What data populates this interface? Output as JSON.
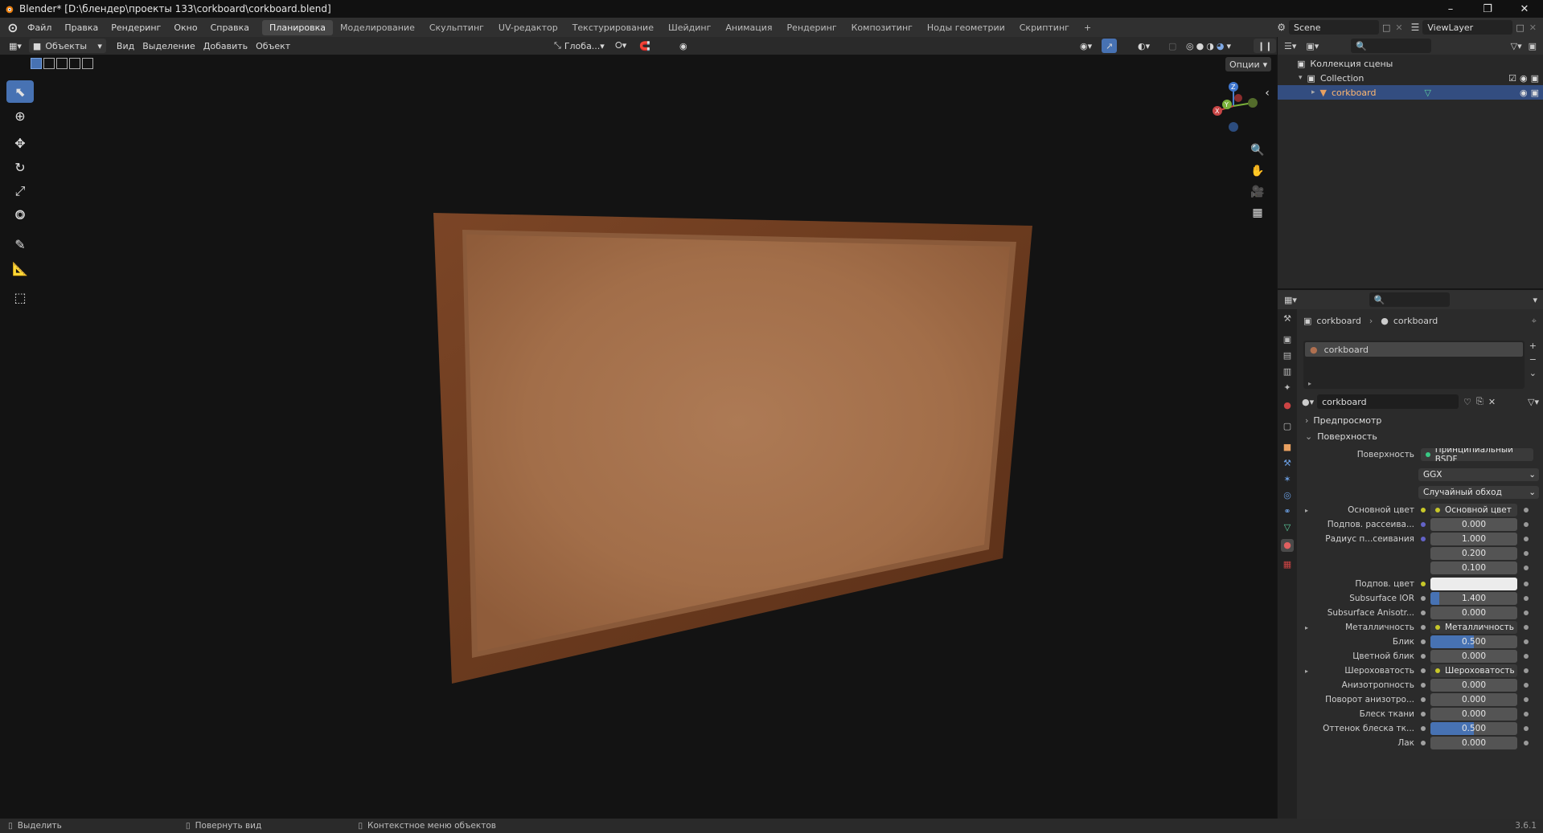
{
  "titlebar": {
    "title": "Blender* [D:\\блендер\\проекты 133\\corkboard\\corkboard.blend]",
    "minimize_icon": "minimize-icon",
    "maximize_icon": "maximize-icon",
    "close_icon": "close-icon"
  },
  "menu": {
    "file": "Файл",
    "edit": "Правка",
    "render": "Рендеринг",
    "window": "Окно",
    "help": "Справка"
  },
  "workspaces": [
    {
      "label": "Планировка",
      "active": true
    },
    {
      "label": "Моделирование"
    },
    {
      "label": "Скульптинг"
    },
    {
      "label": "UV-редактор"
    },
    {
      "label": "Текстурирование"
    },
    {
      "label": "Шейдинг"
    },
    {
      "label": "Анимация"
    },
    {
      "label": "Рендеринг"
    },
    {
      "label": "Композитинг"
    },
    {
      "label": "Ноды геометрии"
    },
    {
      "label": "Скриптинг"
    },
    {
      "label": "+"
    }
  ],
  "scene": {
    "label": "Scene",
    "viewlayer": "ViewLayer"
  },
  "viewport_header": {
    "mode": "Объекты",
    "view": "Вид",
    "select": "Выделение",
    "add": "Добавить",
    "object": "Объект",
    "transform_orientation": "Глоба...",
    "options": "Опции"
  },
  "outliner": {
    "scene_collection": "Коллекция сцены",
    "collection": "Collection",
    "object": "corkboard"
  },
  "properties": {
    "breadcrumb_object": "corkboard",
    "breadcrumb_material": "corkboard",
    "slot": "corkboard",
    "material_name": "corkboard",
    "panel_preview": "Предпросмотр",
    "panel_surface": "Поверхность",
    "surface_label": "Поверхность",
    "surface_value": "Принципиальный BSDF",
    "distribution": "GGX",
    "subsurface_method": "Случайный обход",
    "rows": [
      {
        "label": "Основной цвет",
        "value": "Основной цвет",
        "type": "link",
        "dot": "#c7c729",
        "expand": true
      },
      {
        "label": "Подпов. рассеива...",
        "value": "0.000",
        "type": "num",
        "dot": "#6363c7",
        "fill": 0
      },
      {
        "label": "Радиус п...сеивания",
        "value": "1.000",
        "type": "num",
        "dot": "#6363c7",
        "fill": 0
      },
      {
        "label": "",
        "value": "0.200",
        "type": "num",
        "dot": "",
        "fill": 0
      },
      {
        "label": "",
        "value": "0.100",
        "type": "num",
        "dot": "",
        "fill": 0
      },
      {
        "label": "Подпов. цвет",
        "value": "",
        "type": "color",
        "dot": "#c7c729",
        "color": "#ececec"
      },
      {
        "label": "Subsurface IOR",
        "value": "1.400",
        "type": "num",
        "dot": "#a1a1a1",
        "fill": 0.1
      },
      {
        "label": "Subsurface Anisotr...",
        "value": "0.000",
        "type": "num",
        "dot": "#a1a1a1",
        "fill": 0
      },
      {
        "label": "Металличность",
        "value": "Металличность",
        "type": "link",
        "dot": "#a1a1a1",
        "expand": true
      },
      {
        "label": "Блик",
        "value": "0.500",
        "type": "num",
        "dot": "#a1a1a1",
        "fill": 0.5
      },
      {
        "label": "Цветной блик",
        "value": "0.000",
        "type": "num",
        "dot": "#a1a1a1",
        "fill": 0
      },
      {
        "label": "Шероховатость",
        "value": "Шероховатость",
        "type": "link",
        "dot": "#a1a1a1",
        "expand": true
      },
      {
        "label": "Анизотропность",
        "value": "0.000",
        "type": "num",
        "dot": "#a1a1a1",
        "fill": 0
      },
      {
        "label": "Поворот анизотро...",
        "value": "0.000",
        "type": "num",
        "dot": "#a1a1a1",
        "fill": 0
      },
      {
        "label": "Блеск ткани",
        "value": "0.000",
        "type": "num",
        "dot": "#a1a1a1",
        "fill": 0
      },
      {
        "label": "Оттенок блеска тк...",
        "value": "0.500",
        "type": "num",
        "dot": "#a1a1a1",
        "fill": 0.5
      },
      {
        "label": "Лак",
        "value": "0.000",
        "type": "num",
        "dot": "#a1a1a1",
        "fill": 0
      }
    ]
  },
  "statusbar": {
    "select": "Выделить",
    "rotate": "Повернуть вид",
    "context": "Контекстное меню объектов",
    "version": "3.6.1"
  },
  "colors": {
    "accent": "#4772b3",
    "selection": "#334d80",
    "cork": "#a46e4a",
    "frame": "#6a3a1e"
  }
}
